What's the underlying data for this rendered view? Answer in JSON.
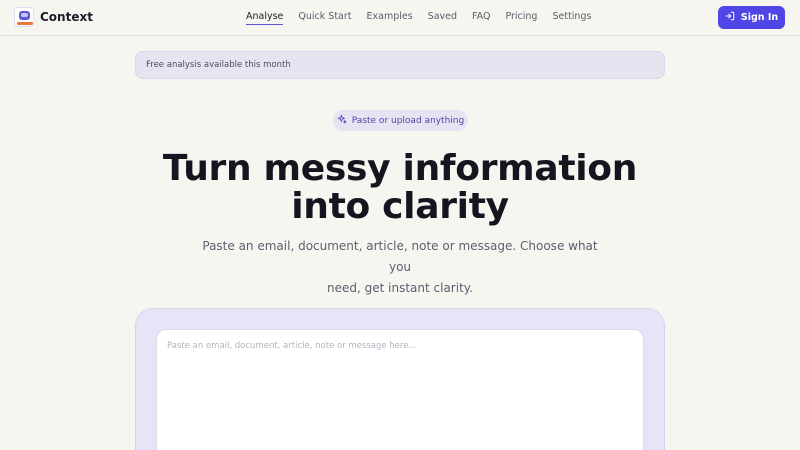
{
  "header": {
    "logo_text": "Context",
    "nav": [
      {
        "label": "Analyse",
        "active": true
      },
      {
        "label": "Quick Start",
        "active": false
      },
      {
        "label": "Examples",
        "active": false
      },
      {
        "label": "Saved",
        "active": false
      },
      {
        "label": "FAQ",
        "active": false
      },
      {
        "label": "Pricing",
        "active": false
      },
      {
        "label": "Settings",
        "active": false
      }
    ],
    "signin_label": "Sign In"
  },
  "banner": {
    "text": "Free analysis available this month"
  },
  "hero": {
    "pill_label": "Paste or upload anything",
    "title_line1": "Turn messy information",
    "title_line2": "into clarity",
    "subtitle_line1": "Paste an email, document, article, note or message. Choose what you",
    "subtitle_line2": "need, get instant clarity."
  },
  "input": {
    "placeholder": "Paste an email, document, article, note or message here..."
  },
  "colors": {
    "accent": "#4f46e5",
    "background": "#f6f5f0",
    "panel": "#e6e4f6"
  },
  "icons": {
    "signin": "sign-in-icon",
    "pill": "sparkles-icon"
  }
}
